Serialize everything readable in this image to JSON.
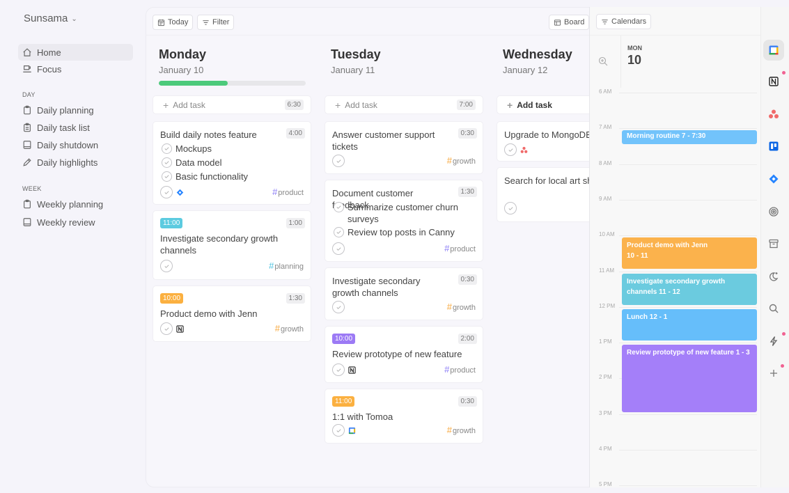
{
  "sidebar": {
    "brand": "Sunsama",
    "nav": [
      {
        "label": "Home",
        "icon": "home-icon",
        "active": true
      },
      {
        "label": "Focus",
        "icon": "coffee-icon",
        "active": false
      }
    ],
    "sections": [
      {
        "title": "DAY",
        "items": [
          {
            "label": "Daily planning",
            "icon": "clipboard-icon"
          },
          {
            "label": "Daily task list",
            "icon": "clipboard-list-icon"
          },
          {
            "label": "Daily shutdown",
            "icon": "book-icon"
          },
          {
            "label": "Daily highlights",
            "icon": "pencil-icon"
          }
        ]
      },
      {
        "title": "WEEK",
        "items": [
          {
            "label": "Weekly planning",
            "icon": "clipboard-icon"
          },
          {
            "label": "Weekly review",
            "icon": "book-icon"
          }
        ]
      }
    ]
  },
  "toolbar": {
    "today_label": "Today",
    "filter_label": "Filter",
    "board_label": "Board",
    "calendars_label": "Calendars"
  },
  "colors": {
    "progress": "#4cca7b",
    "product": "#8b7cf6",
    "growth": "#f7a73b",
    "planning": "#4fc3e0",
    "badge_cyan": "#5ccbe0",
    "badge_orange": "#fbb040",
    "badge_purple": "#9c7af5"
  },
  "days": [
    {
      "name": "Monday",
      "date": "January 10",
      "progress": 0.47,
      "add_task": {
        "label": "Add task",
        "total": "6:30"
      },
      "tasks": [
        {
          "title": "Build daily notes feature",
          "duration": "4:00",
          "subtasks": [
            "Mockups",
            "Data model",
            "Basic functionality"
          ],
          "integration": "jira-icon",
          "tag": "product"
        },
        {
          "badge": "11:00",
          "title": "Investigate secondary growth channels",
          "duration": "1:00",
          "tag": "planning"
        },
        {
          "badge": "10:00",
          "title": "Product demo with Jenn",
          "duration": "1:30",
          "integration": "notion-icon",
          "tag": "growth"
        }
      ]
    },
    {
      "name": "Tuesday",
      "date": "January 11",
      "add_task": {
        "label": "Add task",
        "total": "7:00"
      },
      "tasks": [
        {
          "title": "Answer customer support tickets",
          "duration": "0:30",
          "tag": "growth"
        },
        {
          "title": "Document customer feedback",
          "duration": "1:30",
          "subtasks": [
            "Summarize customer churn surveys",
            "Review top posts in Canny"
          ],
          "tag": "product"
        },
        {
          "title": "Investigate secondary growth channels",
          "duration": "0:30",
          "tag": "growth"
        },
        {
          "badge": "10:00",
          "title": "Review prototype of new feature",
          "duration": "2:00",
          "integration": "notion-icon",
          "tag": "product"
        },
        {
          "badge": "11:00",
          "title": "1:1 with Tomoa",
          "duration": "0:30",
          "integration": "google-calendar-icon",
          "tag": "growth"
        }
      ]
    },
    {
      "name": "Wednesday",
      "date": "January 12",
      "add_task": {
        "label": "Add task"
      },
      "tasks": [
        {
          "title": "Upgrade to MongoDB",
          "integration": "asana-icon"
        },
        {
          "title": "Search for local art shows First Friday"
        }
      ]
    }
  ],
  "calendar": {
    "day_of_week": "MON",
    "day_of_month": "10",
    "hours": [
      "6 AM",
      "7 AM",
      "8 AM",
      "9 AM",
      "10 AM",
      "11 AM",
      "12 PM",
      "1 PM",
      "2 PM",
      "3 PM",
      "4 PM",
      "5 PM"
    ],
    "events": [
      {
        "title": "Morning routine",
        "time": "7 - 7:30",
        "start": 7,
        "end": 7.5,
        "color": "#72c3fb"
      },
      {
        "title": "Product demo with Jenn",
        "time": "10 - 11",
        "start": 10,
        "end": 11,
        "color": "#fbb24c"
      },
      {
        "title": "Investigate secondary growth channels",
        "time": "11 - 12",
        "start": 11,
        "end": 12,
        "color": "#6bcbdf"
      },
      {
        "title": "Lunch",
        "time": "12 - 1",
        "start": 12,
        "end": 13,
        "color": "#66befa"
      },
      {
        "title": "Review prototype of new feature",
        "time": "1 - 3",
        "start": 13,
        "end": 15,
        "color": "#a47ff9"
      }
    ]
  },
  "rail": [
    {
      "icon": "google-calendar-icon",
      "active": true
    },
    {
      "icon": "notion-icon",
      "dot": true
    },
    {
      "icon": "asana-icon"
    },
    {
      "icon": "trello-icon"
    },
    {
      "icon": "jira-icon"
    },
    {
      "icon": "target-icon"
    },
    {
      "icon": "archive-icon"
    },
    {
      "icon": "moon-icon"
    },
    {
      "icon": "search-icon"
    },
    {
      "icon": "lightning-icon",
      "dot": true
    },
    {
      "icon": "plus-icon",
      "dot": true
    }
  ]
}
